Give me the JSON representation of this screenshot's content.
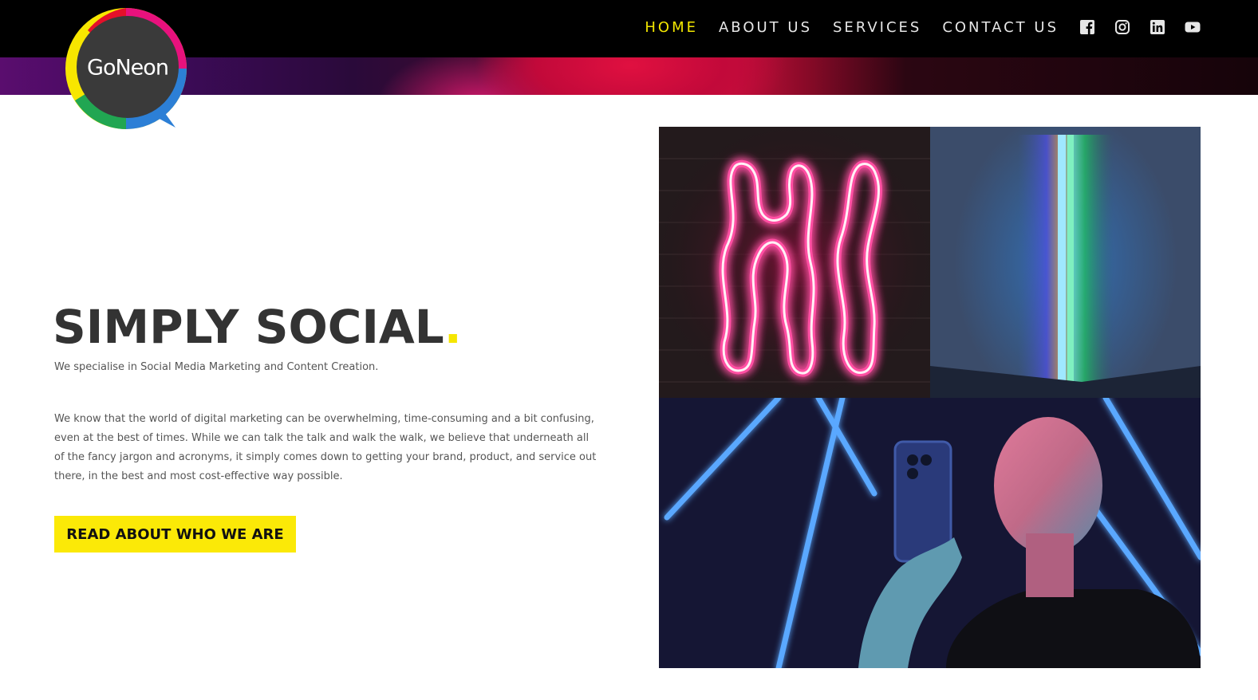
{
  "brand": {
    "logo_text": "GoNeon",
    "logo_icon": "speech-bubble-logo"
  },
  "nav": {
    "items": [
      {
        "label": "HOME",
        "active": true
      },
      {
        "label": "ABOUT US",
        "active": false
      },
      {
        "label": "SERVICES",
        "active": false
      },
      {
        "label": "CONTACT US",
        "active": false
      }
    ],
    "social": [
      "facebook-icon",
      "instagram-icon",
      "linkedin-icon",
      "youtube-icon"
    ]
  },
  "hero": {
    "title": "SIMPLY SOCIAL",
    "title_dot": ".",
    "subtitle": "We specialise in Social Media Marketing and Content Creation.",
    "body": "We know that the world of digital marketing can be overwhelming, time-consuming and a bit confusing, even at the best of times. While we can talk the talk and walk the walk, we believe that underneath all of the fancy jargon and acronyms, it simply comes down to getting your brand, product, and service out there, in the best and most cost-effective way possible.",
    "cta_label": "READ ABOUT WHO WE ARE"
  },
  "images": [
    {
      "name": "neon-hi-sign-image"
    },
    {
      "name": "neon-tube-light-image"
    },
    {
      "name": "woman-selfie-neon-image"
    }
  ],
  "colors": {
    "accent": "#f5e600",
    "header_bg": "#000000",
    "text": "#333333",
    "cta_bg": "#fbe907"
  }
}
